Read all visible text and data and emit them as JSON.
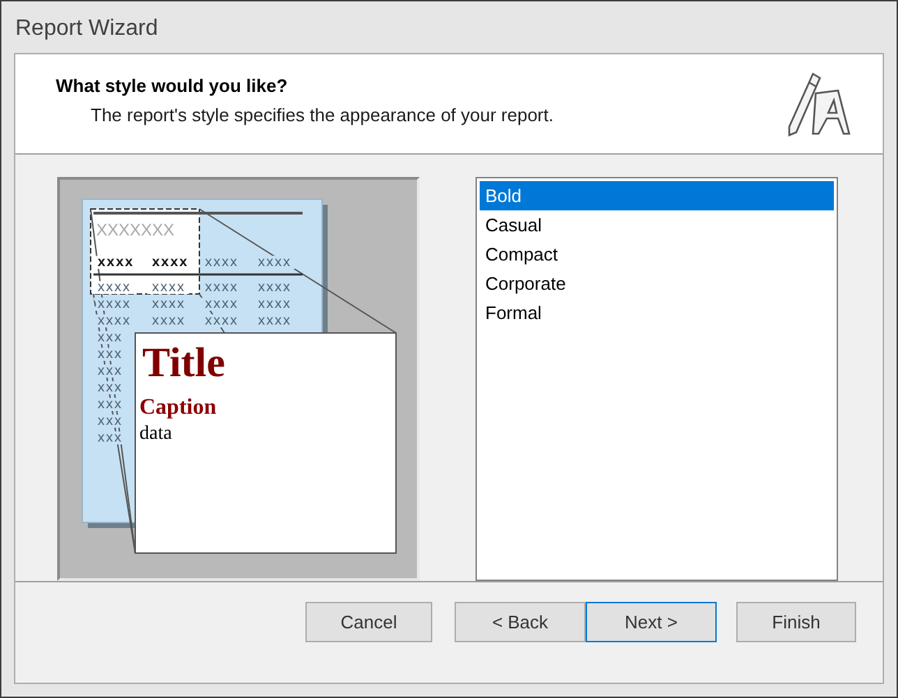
{
  "window": {
    "title": "Report Wizard"
  },
  "header": {
    "heading": "What style would you like?",
    "description": "The report's style specifies the appearance of your report."
  },
  "preview": {
    "heading": "XXXXXXX",
    "header_cells": [
      "xxxx",
      "xxxx",
      "xxxx",
      "xxxx"
    ],
    "rows": [
      [
        "xxxx",
        "xxxx",
        "xxxx",
        "xxxx"
      ],
      [
        "xxxx",
        "xxxx",
        "xxxx",
        "xxxx"
      ],
      [
        "xxxx",
        "xxxx",
        "xxxx",
        "xxxx"
      ],
      [
        "xxx"
      ],
      [
        "xxx"
      ],
      [
        "xxx"
      ],
      [
        "xxx"
      ],
      [
        "xxx"
      ],
      [
        "xxx"
      ],
      [
        "xxx"
      ]
    ],
    "sample": {
      "title": "Title",
      "caption": "Caption",
      "data": "data"
    }
  },
  "styles": [
    {
      "label": "Bold",
      "selected": true
    },
    {
      "label": "Casual",
      "selected": false
    },
    {
      "label": "Compact",
      "selected": false
    },
    {
      "label": "Corporate",
      "selected": false
    },
    {
      "label": "Formal",
      "selected": false
    }
  ],
  "buttons": [
    {
      "label": "Cancel",
      "default": false
    },
    {
      "label": "< Back",
      "default": false
    },
    {
      "label": "Next >",
      "default": true
    },
    {
      "label": "Finish",
      "default": false
    }
  ]
}
